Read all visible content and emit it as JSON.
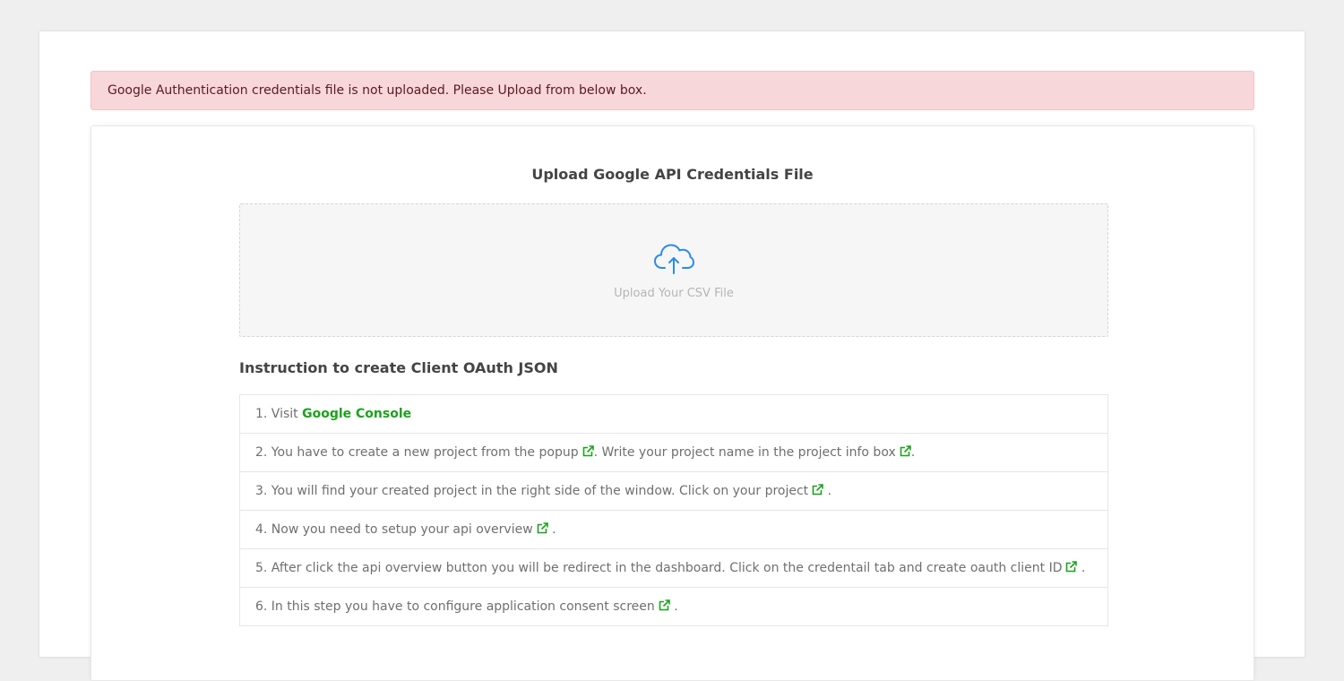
{
  "alert": {
    "message": "Google Authentication credentials file is not uploaded. Please Upload from below box."
  },
  "upload": {
    "title": "Upload Google API Credentials File",
    "dropzone_label": "Upload Your CSV File",
    "icon": "cloud-upload-icon"
  },
  "instructions": {
    "heading": "Instruction to create Client OAuth JSON",
    "link_icon": "external-link-icon",
    "accent_color": "#1aa31a",
    "steps": [
      {
        "prefix": "1. Visit ",
        "link": "Google Console"
      },
      {
        "part1": "2. You have to create a new project from the popup",
        "part2": ". Write your project name in the project info box",
        "suffix": "."
      },
      {
        "text": "3. You will find your created project in the right side of the window. Click on your project",
        "suffix": " ."
      },
      {
        "text": "4. Now you need to setup your api overview",
        "suffix": " ."
      },
      {
        "text": "5. After click the api overview button you will be redirect in the dashboard. Click on the credentail tab and create oauth client ID",
        "suffix": " ."
      },
      {
        "text": "6. In this step you have to configure application consent screen",
        "suffix": " ."
      }
    ]
  }
}
